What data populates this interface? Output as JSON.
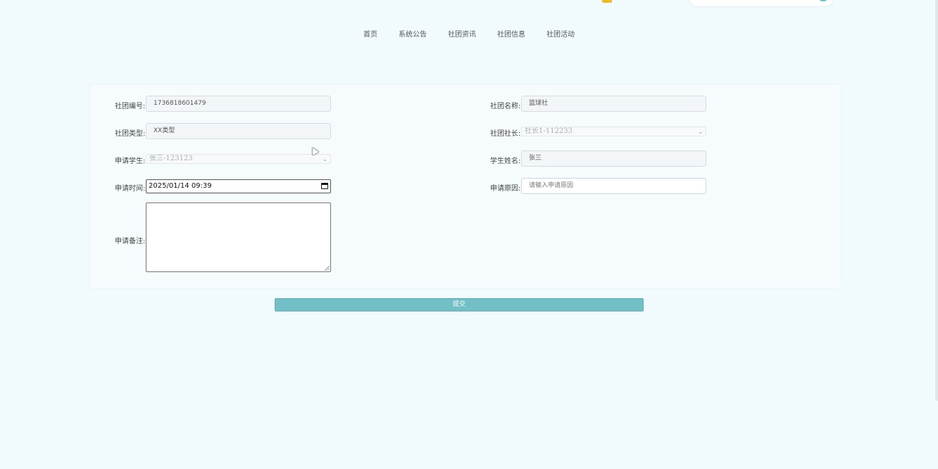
{
  "nav": {
    "items": [
      {
        "label": "首页"
      },
      {
        "label": "系统公告"
      },
      {
        "label": "社团资讯"
      },
      {
        "label": "社团信息"
      },
      {
        "label": "社团活动"
      }
    ]
  },
  "form": {
    "club_id": {
      "label": "社团编号:",
      "value": "1736818601479"
    },
    "club_name": {
      "label": "社团名称:",
      "value": "篮球社"
    },
    "club_type": {
      "label": "社团类型:",
      "value": "XX类型"
    },
    "club_leader": {
      "label": "社团社长:",
      "value": "社长1-112233"
    },
    "applicant": {
      "label": "申请学生:",
      "value": "张三-123123"
    },
    "student_name": {
      "label": "学生姓名:",
      "value": "张三"
    },
    "apply_time": {
      "label": "申请时间:",
      "value": "2025/01/14 09:39"
    },
    "apply_reason": {
      "label": "申请原因:",
      "placeholder": "请输入申请原因"
    },
    "apply_note": {
      "label": "申请备注:",
      "value": ""
    }
  },
  "submit": {
    "label": "提交"
  },
  "colors": {
    "accent": "#73bfc7",
    "page_background": "#f1fbfd",
    "badge": "#f0b92a"
  }
}
